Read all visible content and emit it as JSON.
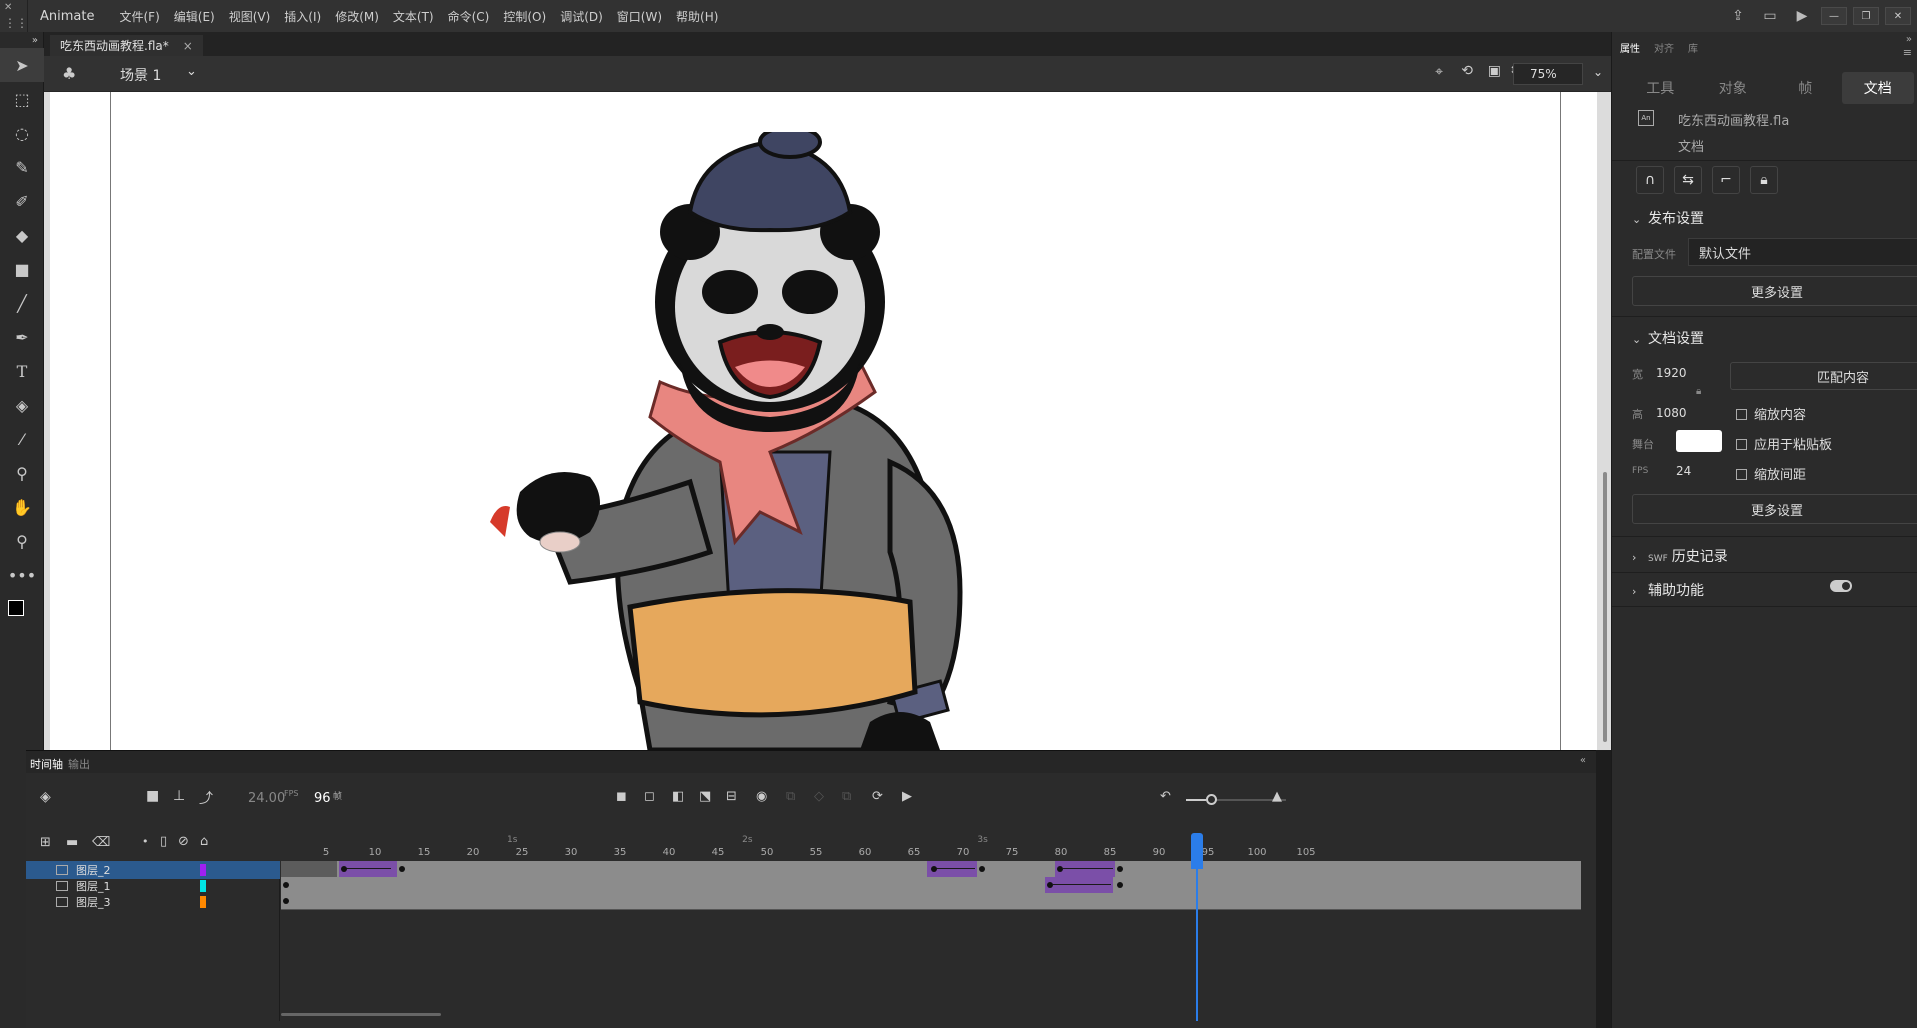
{
  "app": {
    "name": "Animate",
    "menu": [
      "文件(F)",
      "编辑(E)",
      "视图(V)",
      "插入(I)",
      "修改(M)",
      "文本(T)",
      "命令(C)",
      "控制(O)",
      "调试(D)",
      "窗口(W)",
      "帮助(H)"
    ]
  },
  "document": {
    "tab_title": "吃东西动画教程.fla*",
    "tab_close": "×",
    "scene": "场景 1",
    "zoom": "75%"
  },
  "timeline": {
    "tabs": [
      "时间轴",
      "输出"
    ],
    "fps": "24.00",
    "fps_unit": "FPS",
    "current_frame": "96",
    "frame_unit": "帧",
    "ruler_ticks": [
      5,
      10,
      15,
      20,
      25,
      30,
      35,
      40,
      45,
      50,
      55,
      60,
      65,
      70,
      75,
      80,
      85,
      90,
      95,
      100,
      105
    ],
    "seconds": [
      "1s",
      "2s",
      "3s"
    ],
    "layers": [
      {
        "name": "图层_2",
        "color": "#a020f0",
        "selected": true
      },
      {
        "name": "图层_1",
        "color": "#00e5e5",
        "selected": false
      },
      {
        "name": "图层_3",
        "color": "#ff8800",
        "selected": false
      }
    ]
  },
  "properties": {
    "panel_tabs": [
      "属性",
      "对齐",
      "库"
    ],
    "subtabs": [
      "工具",
      "对象",
      "帧",
      "文档"
    ],
    "active_subtab": "文档",
    "file_name": "吃东西动画教程.fla",
    "file_type": "文档",
    "publish": {
      "title": "发布设置",
      "profile_label": "配置文件",
      "profile_value": "默认文件",
      "more": "更多设置"
    },
    "doc_settings": {
      "title": "文档设置",
      "width_label": "宽",
      "width": "1920",
      "height_label": "高",
      "height": "1080",
      "match_content": "匹配内容",
      "stage_label": "舞台",
      "stage_color": "#ffffff",
      "fps_label": "FPS",
      "fps": "24",
      "scale_content": "缩放内容",
      "apply_paste": "应用于粘贴板",
      "scale_spacing": "缩放间距",
      "more": "更多设置"
    },
    "swf_history": {
      "prefix": "SWF",
      "title": "历史记录"
    },
    "accessibility": "辅助功能"
  }
}
